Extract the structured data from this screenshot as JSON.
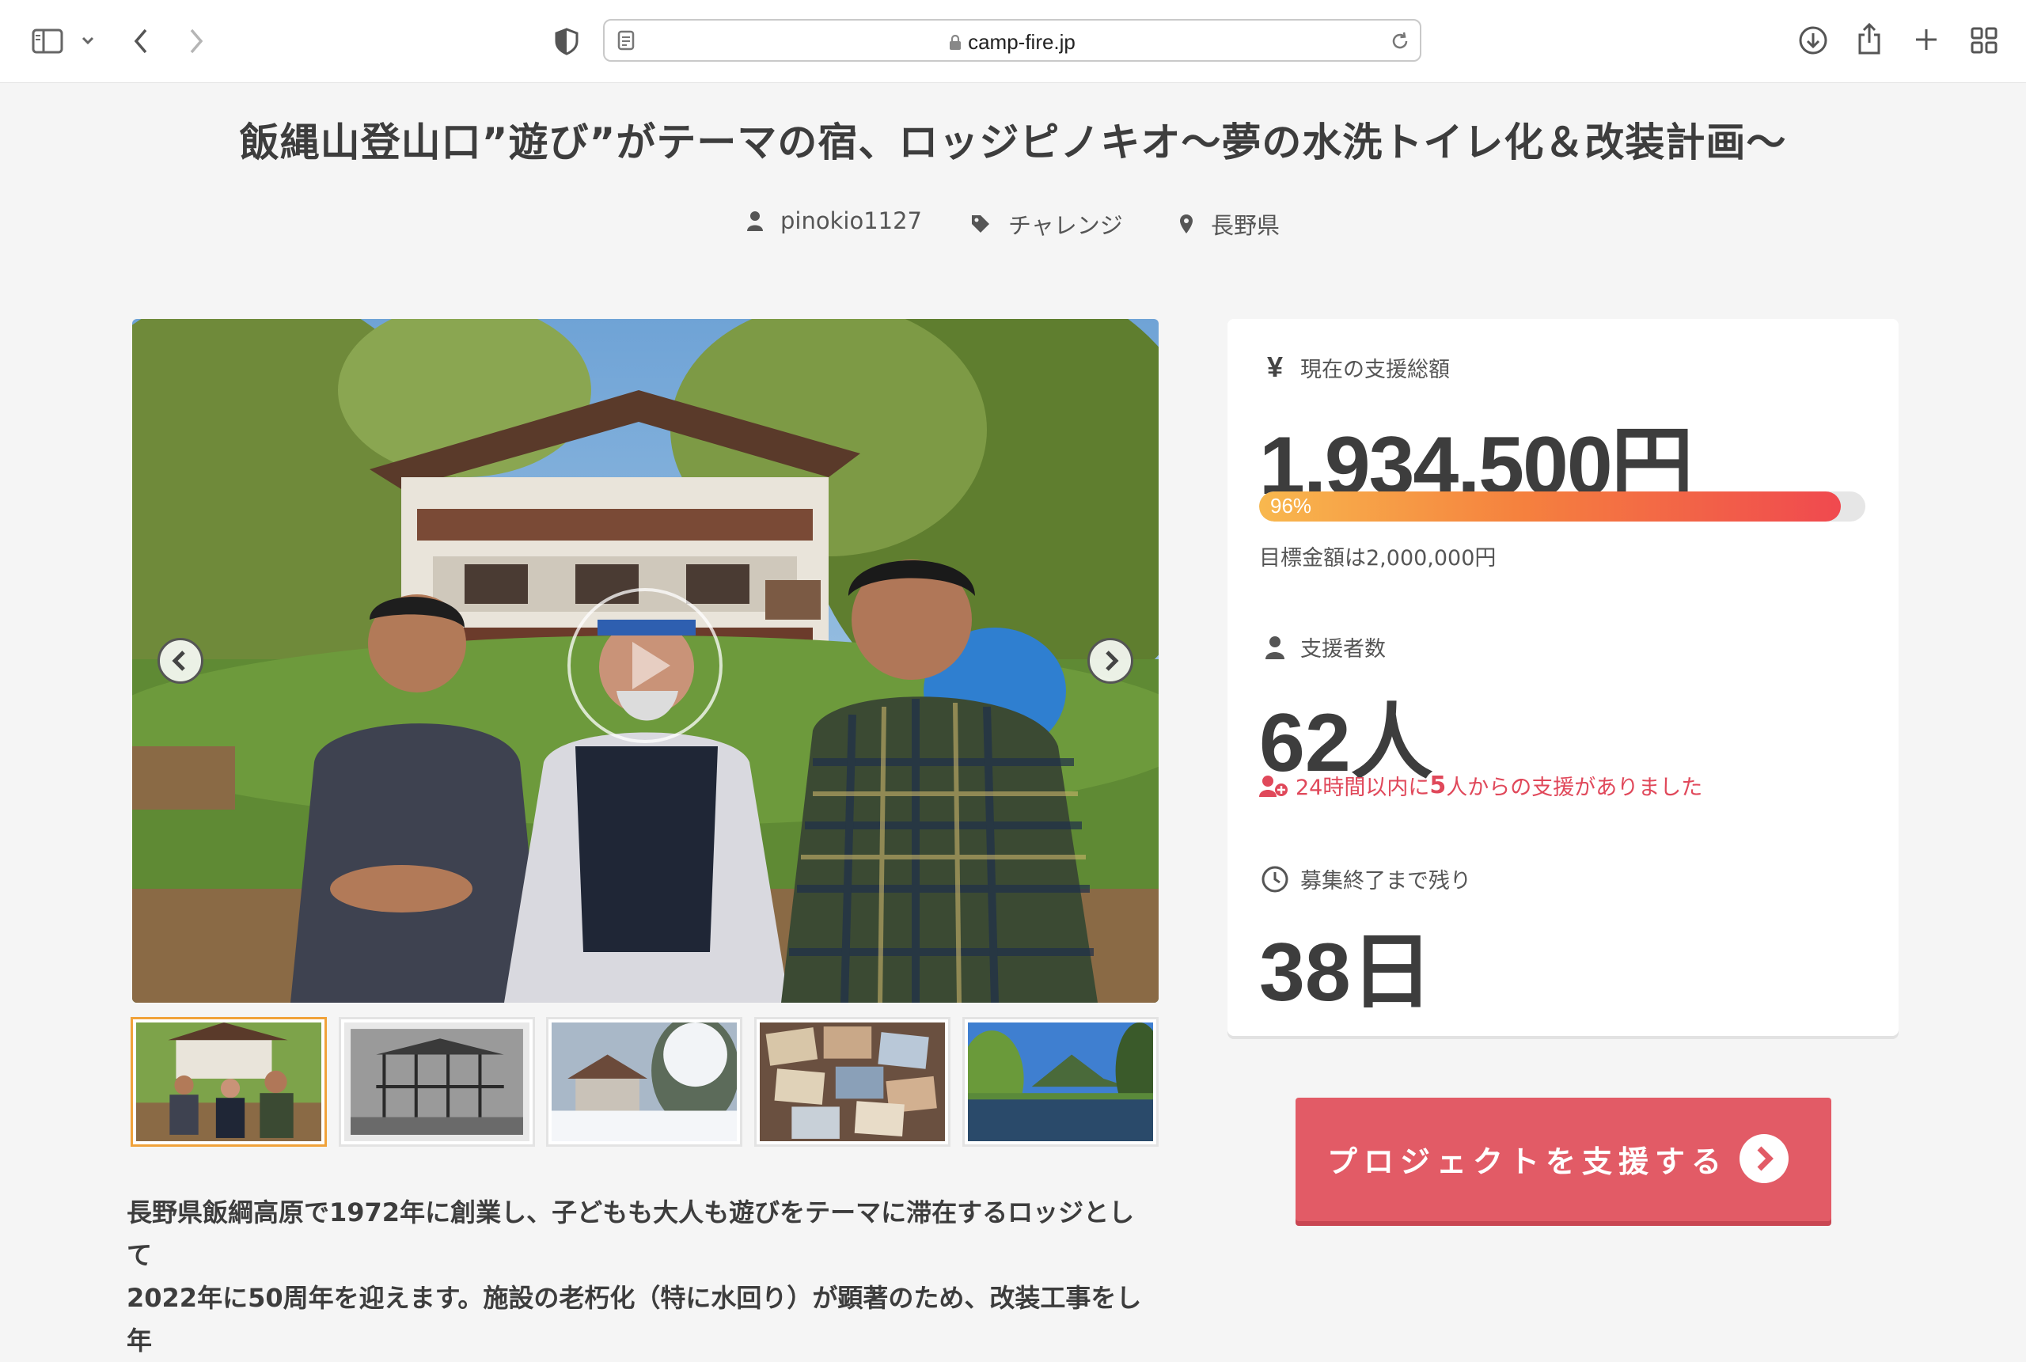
{
  "browser": {
    "url": "camp-fire.jp"
  },
  "project": {
    "title": "飯縄山登山口”遊び”がテーマの宿、ロッジピノキオ〜夢の水洗トイレ化＆改装計画〜",
    "owner": "pinokio1127",
    "category": "チャレンジ",
    "location": "長野県",
    "description_line1": "長野県飯綱高原で1972年に創業し、子どもも大人も遊びをテーマに滞在するロッジとして",
    "description_line2": "2022年に50周年を迎えます。施設の老朽化（特に水回り）が顕著のため、改装工事をし年"
  },
  "stats": {
    "amount_label": "現在の支援総額",
    "amount": "1,934,500円",
    "progress_percent_text": "96%",
    "progress_fraction": 0.96,
    "goal_text": "目標金額は2,000,000円",
    "supporters_label": "支援者数",
    "supporters": "62人",
    "recent_prefix": "24時間以内に",
    "recent_count": "5",
    "recent_suffix": "人からの支援がありました",
    "remaining_label": "募集終了まで残り",
    "remaining": "38日"
  },
  "cta": {
    "label": "プロジェクトを支援する"
  },
  "colors": {
    "accent": "#e25b66",
    "recent_red": "#e0485a",
    "thumb_active": "#f0a23a"
  },
  "icons": [
    "sidebar-icon",
    "chevron-down-icon",
    "back-icon",
    "forward-icon",
    "shield-icon",
    "reader-icon",
    "lock-icon",
    "reload-icon",
    "download-icon",
    "share-icon",
    "plus-icon",
    "tabs-grid-icon",
    "user-icon",
    "tag-icon",
    "map-pin-icon",
    "yen-icon",
    "clock-icon",
    "users-plus-icon",
    "play-icon",
    "arrow-right-circle-icon"
  ]
}
